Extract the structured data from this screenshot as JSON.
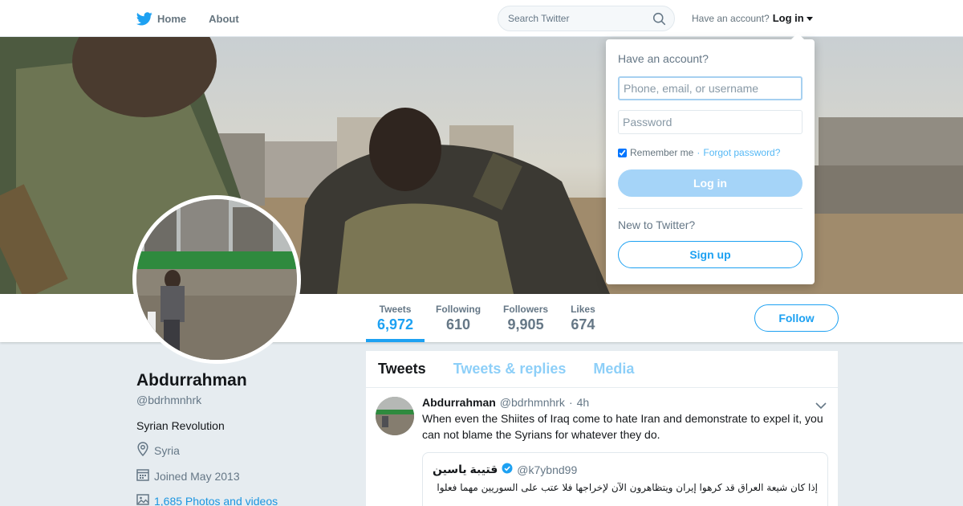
{
  "colors": {
    "brand_blue": "#1da1f2",
    "text_dark": "#14171a",
    "text_muted": "#657786",
    "page_bg": "#e6ecf0"
  },
  "topbar": {
    "home_label": "Home",
    "about_label": "About",
    "search_placeholder": "Search Twitter",
    "have_account": "Have an account?",
    "login_label": "Log in",
    "icons": {
      "logo": "twitter-bird-icon",
      "search": "search-icon",
      "caret": "caret-down-icon"
    }
  },
  "login_dropdown": {
    "heading": "Have an account?",
    "username_placeholder": "Phone, email, or username",
    "password_placeholder": "Password",
    "remember_label": "Remember me",
    "separator": "·",
    "forgot_label": "Forgot password?",
    "login_button": "Log in",
    "new_label": "New to Twitter?",
    "signup_button": "Sign up"
  },
  "profile_nav": {
    "stats": [
      {
        "label": "Tweets",
        "value": "6,972",
        "active": true
      },
      {
        "label": "Following",
        "value": "610",
        "active": false
      },
      {
        "label": "Followers",
        "value": "9,905",
        "active": false
      },
      {
        "label": "Likes",
        "value": "674",
        "active": false
      }
    ],
    "follow_button": "Follow"
  },
  "profile": {
    "name": "Abdurrahman",
    "handle": "@bdrhmnhrk",
    "bio": "Syrian Revolution",
    "location": "Syria",
    "joined": "Joined May 2013",
    "photos": "1,685 Photos and videos",
    "icons": {
      "location": "location-pin-icon",
      "joined": "calendar-icon",
      "photos": "photo-icon"
    }
  },
  "timeline": {
    "tabs": [
      {
        "label": "Tweets",
        "active": true
      },
      {
        "label": "Tweets & replies",
        "active": false
      },
      {
        "label": "Media",
        "active": false
      }
    ],
    "tweet": {
      "name": "Abdurrahman",
      "handle": "@bdrhmnhrk",
      "separator": "·",
      "time": "4h",
      "text": "When even the Shiites of Iraq come to hate Iran and demonstrate to expel it, you can not blame the Syrians for whatever they do.",
      "quote": {
        "name": "قتيبة ياسين",
        "verified": true,
        "handle": "@k7ybnd99",
        "text": "إذا كان شيعة العراق قد كرهوا إيران ويتظاهرون الآن لإخراجها فلا عتب على السوريين مهما فعلوا"
      }
    }
  }
}
